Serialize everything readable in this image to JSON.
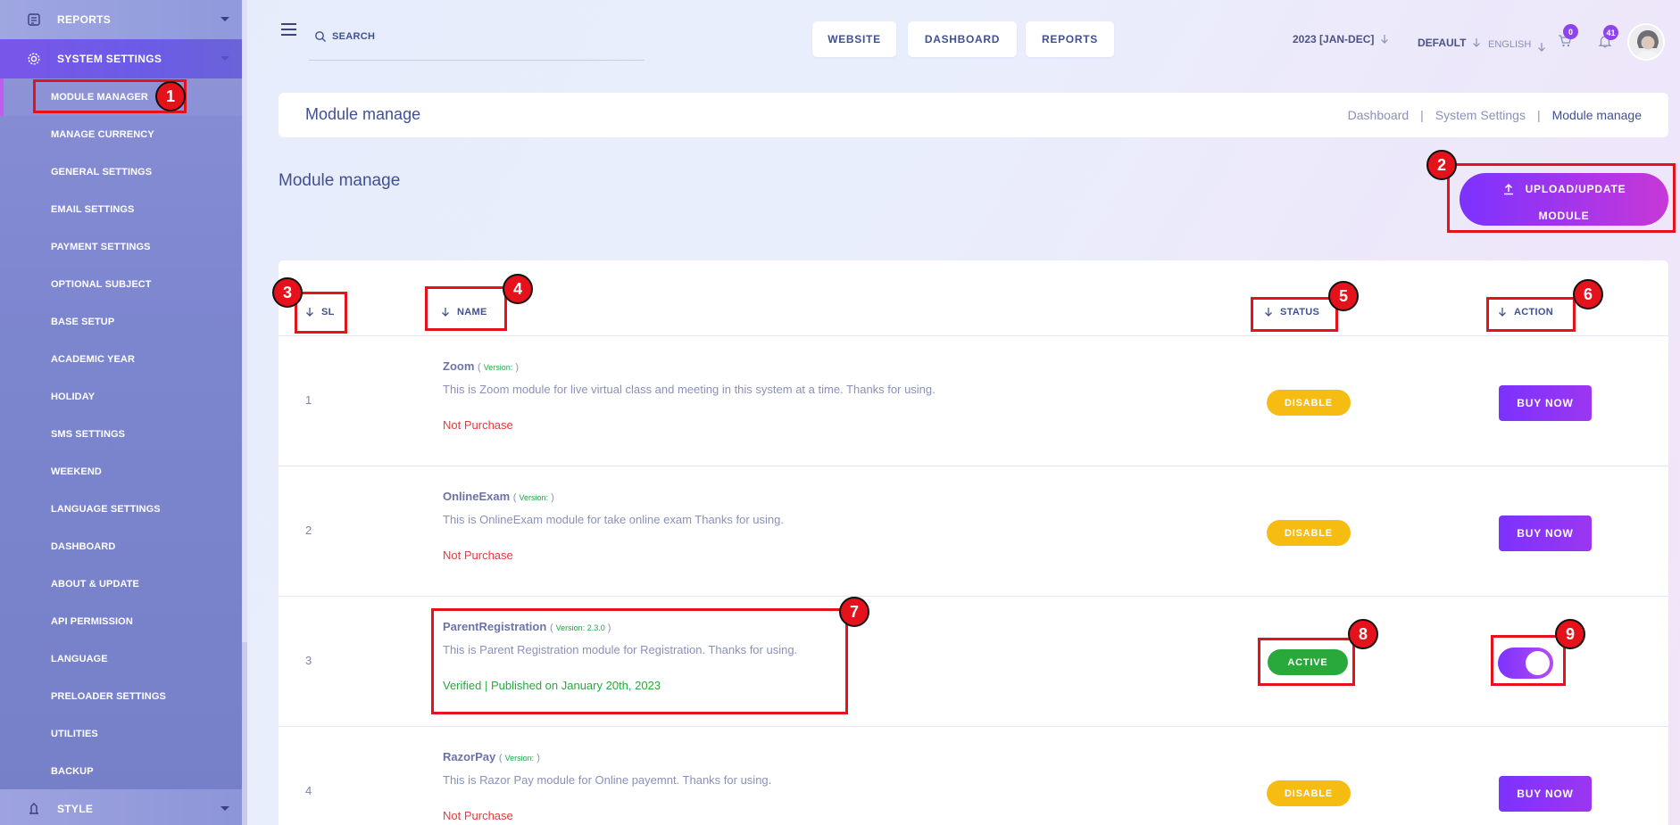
{
  "sidebar": {
    "reports_label": "REPORTS",
    "system_settings_label": "SYSTEM SETTINGS",
    "style_label": "STYLE",
    "items": [
      {
        "label": "MODULE MANAGER"
      },
      {
        "label": "MANAGE CURRENCY"
      },
      {
        "label": "GENERAL SETTINGS"
      },
      {
        "label": "EMAIL SETTINGS"
      },
      {
        "label": "PAYMENT SETTINGS"
      },
      {
        "label": "OPTIONAL SUBJECT"
      },
      {
        "label": "BASE SETUP"
      },
      {
        "label": "ACADEMIC YEAR"
      },
      {
        "label": "HOLIDAY"
      },
      {
        "label": "SMS SETTINGS"
      },
      {
        "label": "WEEKEND"
      },
      {
        "label": "LANGUAGE SETTINGS"
      },
      {
        "label": "DASHBOARD"
      },
      {
        "label": "ABOUT & UPDATE"
      },
      {
        "label": "API PERMISSION"
      },
      {
        "label": "LANGUAGE"
      },
      {
        "label": "PRELOADER SETTINGS"
      },
      {
        "label": "UTILITIES"
      },
      {
        "label": "BACKUP"
      }
    ]
  },
  "topbar": {
    "search_placeholder": "SEARCH",
    "website_label": "WEBSITE",
    "dashboard_label": "DASHBOARD",
    "reports_label": "REPORTS",
    "year_label": "2023 [JAN-DEC]",
    "theme_label": "DEFAULT",
    "language_label": "ENGLISH",
    "cart_count": "0",
    "notification_count": "41"
  },
  "page": {
    "header_title": "Module manage",
    "breadcrumb": [
      "Dashboard",
      "System Settings",
      "Module manage"
    ],
    "breadcrumb_sep": "|",
    "section_title": "Module manage",
    "upload_line1": "UPLOAD/UPDATE",
    "upload_line2": "MODULE"
  },
  "table": {
    "headers": {
      "sl": "SL",
      "name": "NAME",
      "status": "STATUS",
      "action": "ACTION"
    },
    "rows": [
      {
        "sl": "1",
        "name": "Zoom",
        "ver_open": "( ",
        "ver_label": "Version:",
        "ver_value": "",
        "ver_close": " )",
        "desc": "This is Zoom module for live virtual class and meeting in this system at a time. Thanks for using.",
        "status_text": "Not Purchase",
        "status": "DISABLE",
        "action": "BUY NOW"
      },
      {
        "sl": "2",
        "name": "OnlineExam",
        "ver_open": "( ",
        "ver_label": "Version:",
        "ver_value": "",
        "ver_close": " )",
        "desc": "This is OnlineExam module for take online exam Thanks for using.",
        "status_text": "Not Purchase",
        "status": "DISABLE",
        "action": "BUY NOW"
      },
      {
        "sl": "3",
        "name": "ParentRegistration",
        "ver_open": "( ",
        "ver_label": "Version:",
        "ver_value": " 2.3.0",
        "ver_close": " )",
        "desc": "This is Parent Registration module for Registration. Thanks for using.",
        "status_text": "Verified | Published on January 20th, 2023",
        "status": "ACTIVE",
        "action_toggle_on": true
      },
      {
        "sl": "4",
        "name": "RazorPay",
        "ver_open": "( ",
        "ver_label": "Version:",
        "ver_value": "",
        "ver_close": " )",
        "desc": "This is Razor Pay module for Online payemnt. Thanks for using.",
        "status_text": "Not Purchase",
        "status": "DISABLE",
        "action": "BUY NOW"
      }
    ]
  },
  "annotations": [
    "1",
    "2",
    "3",
    "4",
    "5",
    "6",
    "7",
    "8",
    "9"
  ],
  "colors": {
    "accent_purple": "#7c32ff",
    "accent_pink": "#c738d8",
    "disable_yellow": "#f7bc11",
    "active_green": "#29a83c",
    "annotation_red": "#e5121b"
  }
}
